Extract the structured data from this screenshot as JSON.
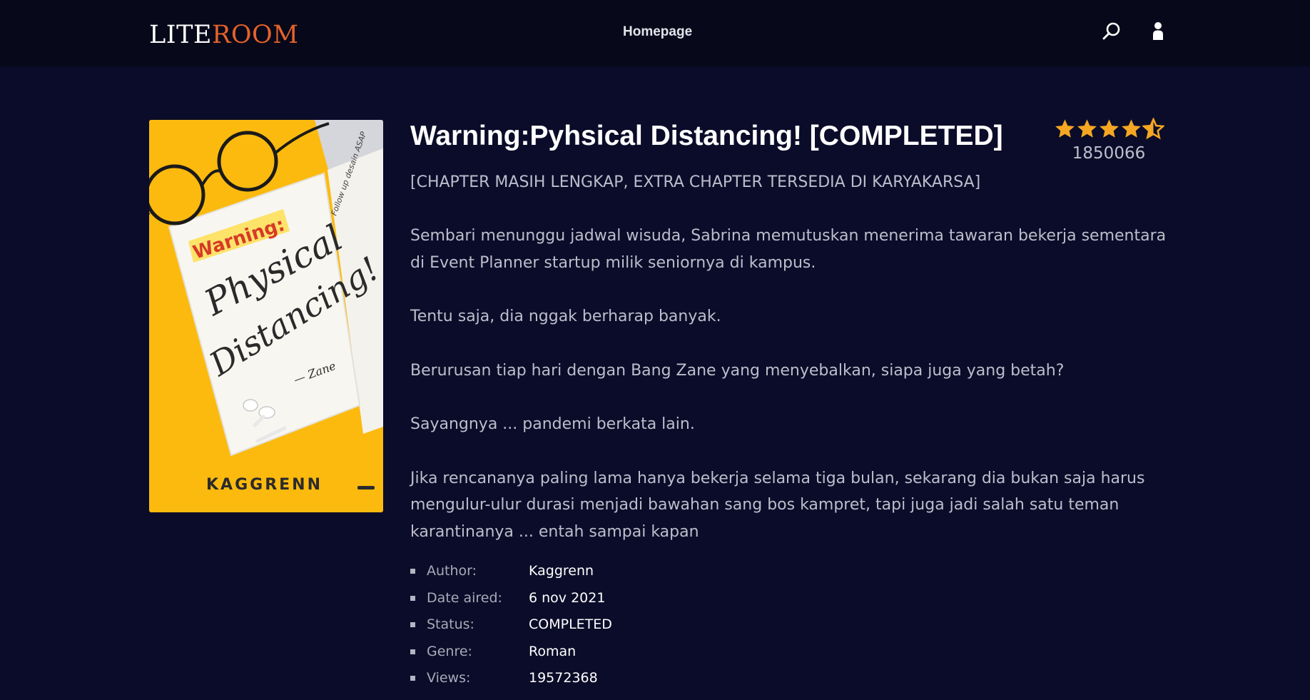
{
  "header": {
    "logo_part1": "LITE",
    "logo_part2": "ROOM",
    "nav_homepage": "Homepage",
    "search_icon": "search-icon",
    "user_icon": "user-icon"
  },
  "book": {
    "cover": {
      "highlight_text": "Warning:",
      "title_line1": "Physical",
      "title_line2": "Distancing!",
      "signature": "— Zane",
      "note_text": "Follow up desain ASAP",
      "author_text": "KAGGRENN"
    },
    "title": "Warning:Pyhsical Distancing! [COMPLETED]",
    "rating": {
      "stars": 4.5,
      "max": 5,
      "count": "1850066"
    },
    "subtitle": "[CHAPTER MASIH LENGKAP, EXTRA CHAPTER TERSEDIA DI KARYAKARSA]",
    "synopsis": [
      "Sembari menunggu jadwal wisuda, Sabrina memutuskan menerima tawaran bekerja sementara di Event Planner startup milik seniornya di kampus.",
      "Tentu saja, dia nggak berharap banyak.",
      "Berurusan tiap hari dengan Bang Zane yang menyebalkan, siapa juga yang betah?",
      "Sayangnya ... pandemi berkata lain.",
      "Jika rencananya paling lama hanya bekerja selama tiga bulan, sekarang dia bukan saja harus mengulur-ulur durasi menjadi bawahan sang bos kampret, tapi juga jadi salah satu teman karantinanya ... entah sampai kapan"
    ],
    "details": [
      {
        "label": "Author:",
        "value": "Kaggrenn"
      },
      {
        "label": "Date aired:",
        "value": "6 nov 2021"
      },
      {
        "label": "Status:",
        "value": "COMPLETED"
      },
      {
        "label": "Genre:",
        "value": "Roman"
      },
      {
        "label": "Views:",
        "value": "19572368"
      }
    ]
  },
  "colors": {
    "background": "#0b0c29",
    "header": "#070819",
    "logo_accent": "#e5622b",
    "star": "#f5a623",
    "cover_yellow": "#fcba0e"
  }
}
